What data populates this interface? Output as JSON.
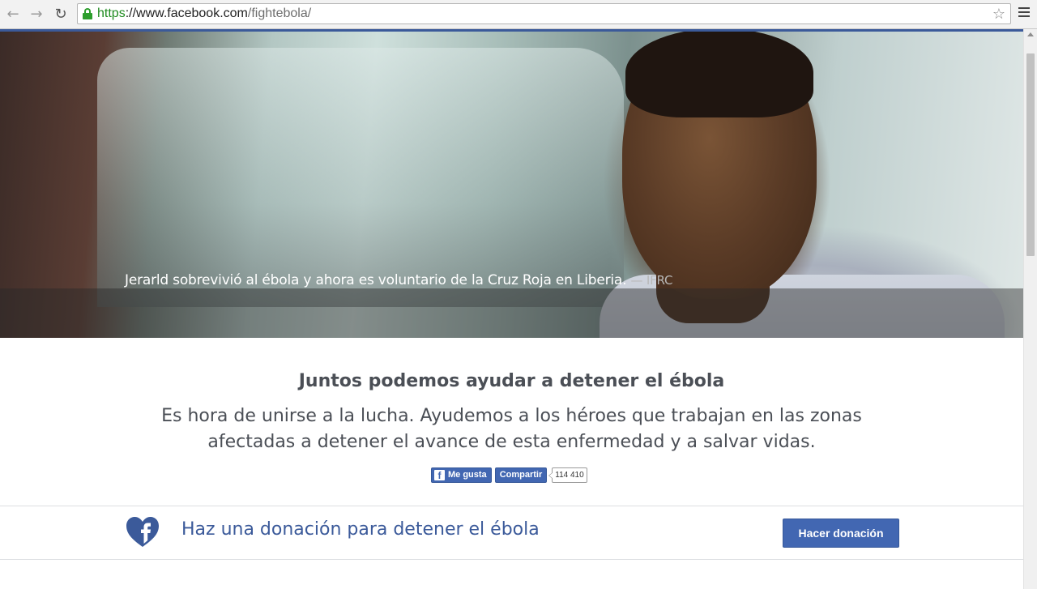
{
  "browser": {
    "url_scheme": "https",
    "url_separator": "://",
    "url_host": "www.facebook.com",
    "url_path": "/fightebola/",
    "icons": {
      "back": "back-arrow-icon",
      "forward": "forward-arrow-icon",
      "reload": "reload-icon",
      "secure": "lock-icon",
      "bookmark": "star-icon",
      "menu": "hamburger-menu-icon"
    }
  },
  "hero": {
    "caption": "Jerarld sobrevivió al ébola y ahora es voluntario de la Cruz Roja en Liberia.",
    "credit": "— IFRC"
  },
  "main": {
    "headline": "Juntos podemos ayudar a detener el ébola",
    "subtext": "Es hora de unirse a la lucha. Ayudemos a los héroes que trabajan en las zonas afectadas a detener el avance de esta enfermedad y a salvar vidas."
  },
  "social": {
    "like_label": "Me gusta",
    "share_label": "Compartir",
    "count": "114 410"
  },
  "donation": {
    "text": "Haz una donación para detener el ébola",
    "button_label": "Hacer donación",
    "icon": "facebook-heart-icon"
  },
  "colors": {
    "brand_blue": "#3b5a9a",
    "button_blue": "#4267b2",
    "text_gray": "#4b4f56",
    "secure_green": "#2d9e2d"
  }
}
